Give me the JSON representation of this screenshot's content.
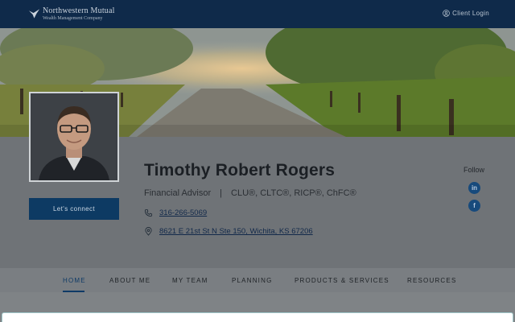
{
  "header": {
    "logo_line1": "Northwestern Mutual",
    "logo_line2": "Wealth Management Company",
    "client_login": "Client Login"
  },
  "profile": {
    "name": "Timothy Robert Rogers",
    "title": "Financial Advisor",
    "separator": "|",
    "credentials": "CLU®, CLTC®, RICP®, ChFC®",
    "phone": "316-266-5069",
    "address": "8621 E 21st St N Ste 150, Wichita, KS 67206",
    "connect_label": "Let's connect",
    "follow_label": "Follow",
    "social": {
      "linkedin": "in",
      "facebook": "f"
    }
  },
  "nav": {
    "items": [
      {
        "label": "HOME",
        "active": true
      },
      {
        "label": "ABOUT ME"
      },
      {
        "label": "MY TEAM"
      },
      {
        "label": "PLANNING"
      },
      {
        "label": "PRODUCTS & SERVICES"
      },
      {
        "label": "RESOURCES"
      }
    ]
  },
  "colors": {
    "header_bg": "#0f2a4a",
    "accent": "#0d3a63",
    "social": "#174a7c"
  },
  "icons": [
    "logo-eagle-icon",
    "user-icon",
    "phone-icon",
    "map-pin-icon",
    "linkedin-icon",
    "facebook-icon"
  ]
}
